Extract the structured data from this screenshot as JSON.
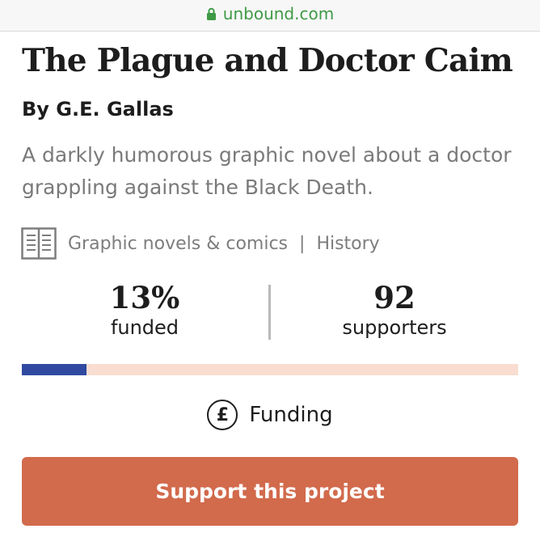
{
  "browser": {
    "url": "unbound.com"
  },
  "project": {
    "title": "The Plague and Doctor Caim",
    "author": "By G.E. Gallas",
    "description": "A darkly humorous graphic novel about a doctor grappling against the Black Death.",
    "categories": [
      "Graphic novels & comics",
      "History"
    ],
    "separator": "|"
  },
  "stats": {
    "funded_percent": "13%",
    "funded_label": "funded",
    "supporters_count": "92",
    "supporters_label": "supporters",
    "progress_fraction": 0.13
  },
  "colors": {
    "progress_fill": "#2f4aa0",
    "progress_track": "#f8ddd0",
    "cta_background": "#d26a4c",
    "url_green": "#3f9a46"
  },
  "funding": {
    "icon": "pound-icon",
    "label": "Funding"
  },
  "cta": {
    "label": "Support this project"
  }
}
